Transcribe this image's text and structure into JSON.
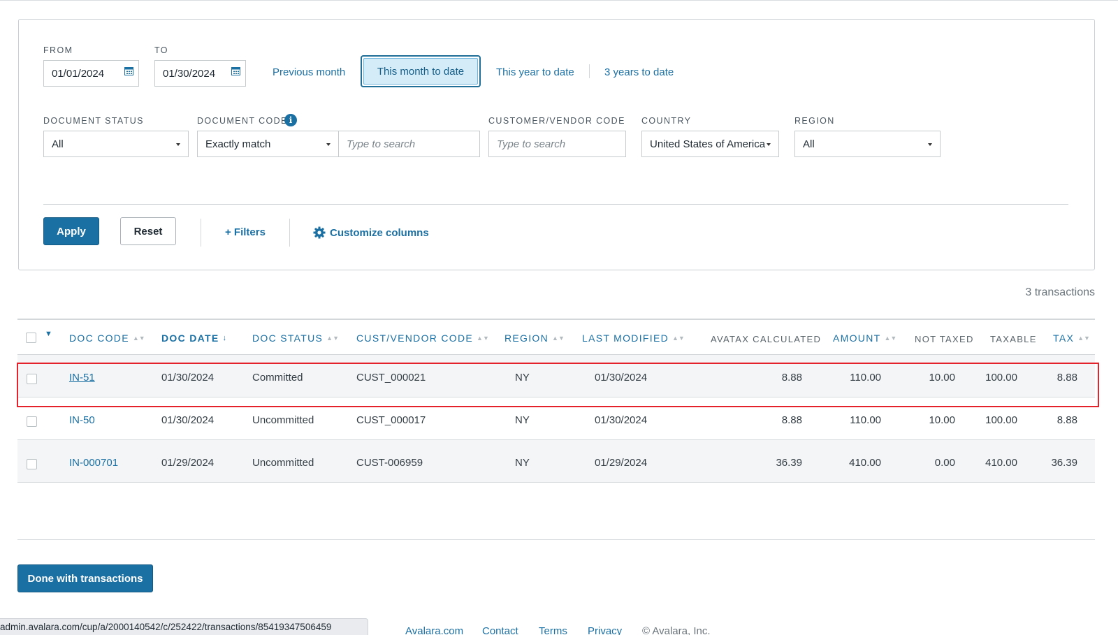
{
  "filters": {
    "from_label": "FROM",
    "from_value": "01/01/2024",
    "to_label": "TO",
    "to_value": "01/30/2024",
    "quick_ranges": [
      "Previous month",
      "This month to date",
      "This year to date",
      "3 years to date"
    ],
    "active_range": "This month to date",
    "document_status_label": "DOCUMENT STATUS",
    "document_status_value": "All",
    "document_code_label": "DOCUMENT CODE",
    "document_code_match": "Exactly match",
    "document_code_placeholder": "Type to search",
    "customer_vendor_label": "CUSTOMER/VENDOR CODE",
    "customer_vendor_placeholder": "Type to search",
    "country_label": "COUNTRY",
    "country_value": "United States of America",
    "region_label": "REGION",
    "region_value": "All"
  },
  "actions": {
    "apply": "Apply",
    "reset": "Reset",
    "filters": "+ Filters",
    "customize": "Customize columns"
  },
  "summary": {
    "count": "3 transactions"
  },
  "table": {
    "headers": {
      "doc_code": "DOC CODE",
      "doc_date": "DOC DATE",
      "doc_status": "DOC STATUS",
      "cust_vendor": "CUST/VENDOR CODE",
      "region": "REGION",
      "last_modified": "LAST MODIFIED",
      "avatax": "AVATAX CALCULATED",
      "amount": "AMOUNT",
      "not_taxed": "NOT TAXED",
      "taxable": "TAXABLE",
      "tax": "TAX"
    },
    "rows": [
      {
        "doc_code": "IN-51",
        "doc_date": "01/30/2024",
        "doc_status": "Committed",
        "cust_vendor": "CUST_000021",
        "region": "NY",
        "last_modified": "01/30/2024",
        "avatax": "8.88",
        "amount": "110.00",
        "not_taxed": "10.00",
        "taxable": "100.00",
        "tax": "8.88"
      },
      {
        "doc_code": "IN-50",
        "doc_date": "01/30/2024",
        "doc_status": "Uncommitted",
        "cust_vendor": "CUST_000017",
        "region": "NY",
        "last_modified": "01/30/2024",
        "avatax": "8.88",
        "amount": "110.00",
        "not_taxed": "10.00",
        "taxable": "100.00",
        "tax": "8.88"
      },
      {
        "doc_code": "IN-000701",
        "doc_date": "01/29/2024",
        "doc_status": "Uncommitted",
        "cust_vendor": "CUST-006959",
        "region": "NY",
        "last_modified": "01/29/2024",
        "avatax": "36.39",
        "amount": "410.00",
        "not_taxed": "0.00",
        "taxable": "410.00",
        "tax": "36.39"
      }
    ]
  },
  "done_button": "Done with transactions",
  "status_url": "admin.avalara.com/cup/a/2000140542/c/252422/transactions/85419347506459",
  "footer": {
    "links": [
      "Avalara.com",
      "Contact",
      "Terms",
      "Privacy"
    ],
    "copyright": "© Avalara, Inc."
  },
  "colors": {
    "accent": "#1a6fa3",
    "highlight_border": "#e3222b",
    "active_range_bg": "#d4ecf8"
  }
}
